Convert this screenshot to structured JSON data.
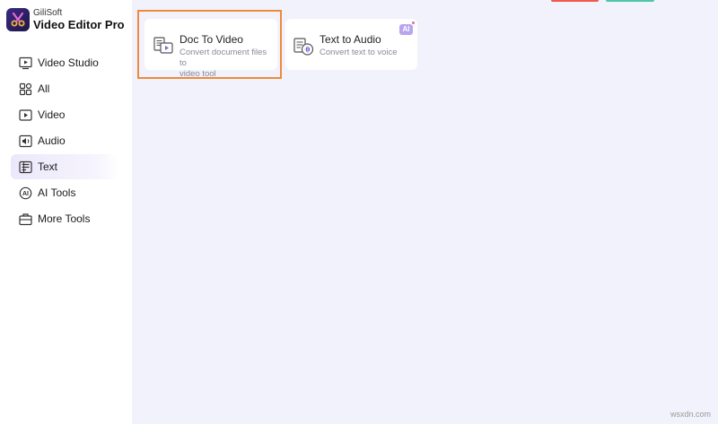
{
  "app": {
    "brand": "GiliSoft",
    "product": "Video Editor Pro"
  },
  "sidebar": {
    "items": [
      {
        "label": "Video Studio",
        "icon": "video-studio-icon"
      },
      {
        "label": "All",
        "icon": "grid-icon"
      },
      {
        "label": "Video",
        "icon": "video-icon"
      },
      {
        "label": "Audio",
        "icon": "audio-icon"
      },
      {
        "label": "Text",
        "icon": "text-icon",
        "active": true
      },
      {
        "label": "AI Tools",
        "icon": "ai-icon"
      },
      {
        "label": "More Tools",
        "icon": "toolbox-icon"
      }
    ]
  },
  "cards": [
    {
      "title": "Doc To Video",
      "desc_line1": "Convert document files to",
      "desc_line2": "video tool",
      "icon": "doc-to-video-icon",
      "highlighted": true
    },
    {
      "title": "Text to Audio",
      "desc_line1": "Convert text to voice",
      "icon": "text-to-audio-icon",
      "badge": "AI"
    }
  ],
  "colors": {
    "accent": "#7b61d9",
    "highlight": "#ef8a3b",
    "background": "#f1f2fb",
    "top_red": "#ef5a4a",
    "top_green": "#4fc7a6"
  },
  "watermark": "wsxdn.com"
}
